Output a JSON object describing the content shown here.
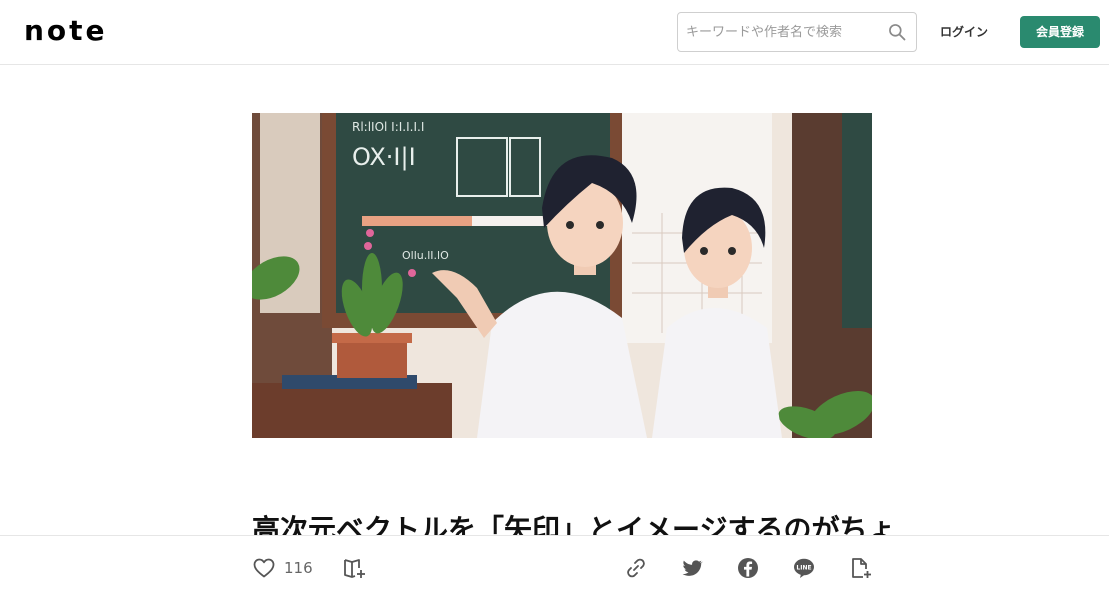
{
  "header": {
    "logo": "note",
    "search_placeholder": "キーワードや作者名で検索",
    "login_label": "ログイン",
    "signup_label": "会員登録"
  },
  "article": {
    "title": "高次元ベクトルを「矢印」とイメージするのがちょ"
  },
  "actions": {
    "like_count": "116"
  },
  "colors": {
    "accent": "#2a8a6f",
    "icon": "#555555"
  },
  "icons": [
    "search-icon",
    "heart-icon",
    "magazine-add-icon",
    "link-icon",
    "twitter-icon",
    "facebook-icon",
    "line-icon",
    "embed-icon"
  ]
}
